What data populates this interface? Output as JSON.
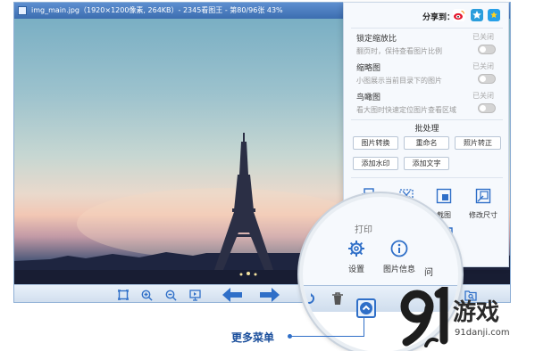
{
  "window": {
    "title": "img_main.jpg（1920×1200像素, 264KB）- 2345看图王 - 第80/96张 43%"
  },
  "share": {
    "label": "分享到：",
    "icons": [
      "weibo-icon",
      "qzone-icon",
      "qq-icon"
    ]
  },
  "options": [
    {
      "title": "锁定缩放比",
      "status": "已关闭",
      "desc": "翻页时，保持查看图片比例",
      "enabled": false
    },
    {
      "title": "缩略图",
      "status": "已关闭",
      "desc": "小图展示当前目录下的图片",
      "enabled": false
    },
    {
      "title": "鸟瞰图",
      "status": "已关闭",
      "desc": "看大图时快速定位图片查看区域",
      "enabled": false
    }
  ],
  "batch": {
    "title": "批处理",
    "buttons": [
      "图片转换",
      "重命名",
      "照片转正",
      "添加水印",
      "添加文字"
    ]
  },
  "tools": [
    "打印",
    "裁剪",
    "截图",
    "修改尺寸",
    "问题反馈"
  ],
  "magnifier": {
    "ghost_label": "打印",
    "settings": "设置",
    "info": "图片信息",
    "cut_label": "问"
  },
  "callout": {
    "label": "更多菜单"
  },
  "logo": {
    "main": "游戏",
    "sub": "91danji.com"
  },
  "colors": {
    "accent": "#2f6fc8",
    "titlebar": "#3c6db0",
    "toggle_off": "#d4d4d4"
  }
}
